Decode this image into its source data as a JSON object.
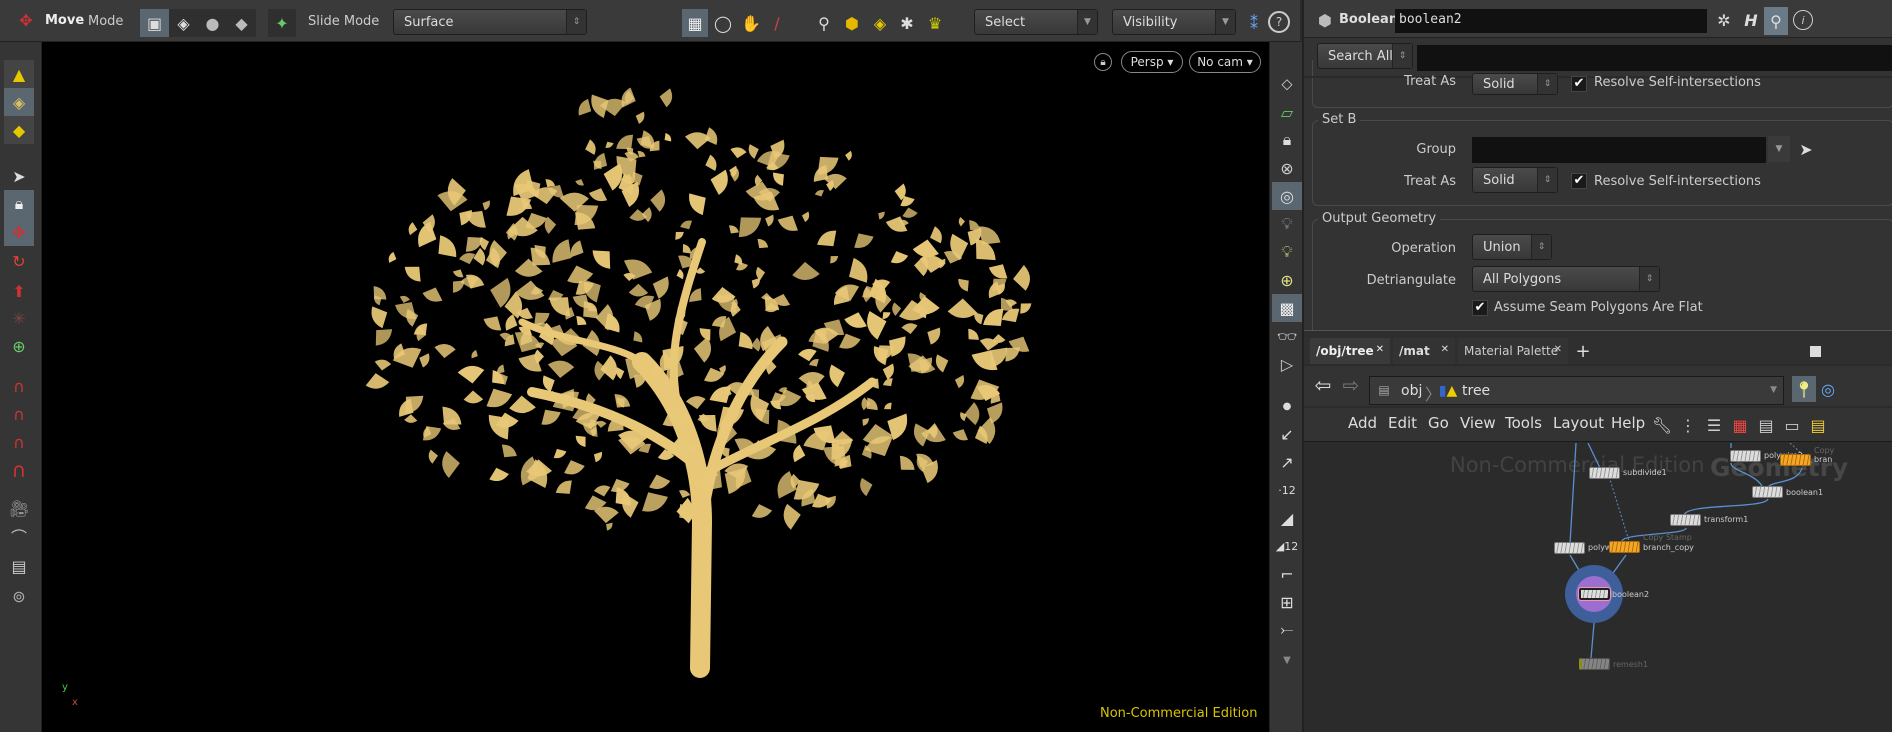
{
  "toolbar": {
    "tool": "Move",
    "mode_label": "Mode",
    "slide_mode_label": "Slide Mode",
    "slide_mode_value": "Surface",
    "select_value": "Select",
    "visibility_value": "Visibility"
  },
  "viewport": {
    "camera": "Persp",
    "cam_menu": "No cam",
    "watermark": "Non-Commercial Edition",
    "axis_x": "x",
    "axis_y": "y"
  },
  "params": {
    "node_type": "Boolean",
    "node_name": "boolean2",
    "search_mode": "Search All",
    "search_value": "",
    "set_a": {
      "treat_as_label": "Treat As",
      "treat_as": "Solid",
      "resolve_label": "Resolve Self-intersections",
      "resolve": true
    },
    "set_b": {
      "title": "Set B",
      "group_label": "Group",
      "group_value": "",
      "treat_as_label": "Treat As",
      "treat_as": "Solid",
      "resolve_label": "Resolve Self-intersections",
      "resolve": true
    },
    "output": {
      "title": "Output Geometry",
      "operation_label": "Operation",
      "operation": "Union",
      "detriangulate_label": "Detriangulate",
      "detriangulate": "All Polygons",
      "seam_label": "Assume Seam Polygons Are Flat",
      "seam": true
    }
  },
  "network": {
    "tabs": [
      {
        "label": "/obj/tree"
      },
      {
        "label": "/mat"
      },
      {
        "label": "Material Palette"
      }
    ],
    "path": [
      "obj",
      "tree"
    ],
    "menu": [
      "Add",
      "Edit",
      "Go",
      "View",
      "Tools",
      "Layout",
      "Help"
    ],
    "watermark": "Non-Commercial Edition",
    "context_label": "Geometry",
    "nodes": {
      "subdivide": "subdivide1",
      "polywire2": "polywire2",
      "branch": "bran",
      "branch_sub": "Copy",
      "boolean1": "boolean1",
      "transform": "transform1",
      "polywire1": "polywire1",
      "branch_copy": "branch_copy",
      "copy_stamp": "Copy Stamp",
      "boolean2": "boolean2",
      "remesh": "remesh1"
    }
  },
  "colors": {
    "geometry": "#e8c877",
    "accent_orange": "#f5a623",
    "selected_ring": "#3f5f9a",
    "selected_inner": "#9b6fd0",
    "watermark_yellow": "#d9c400"
  }
}
